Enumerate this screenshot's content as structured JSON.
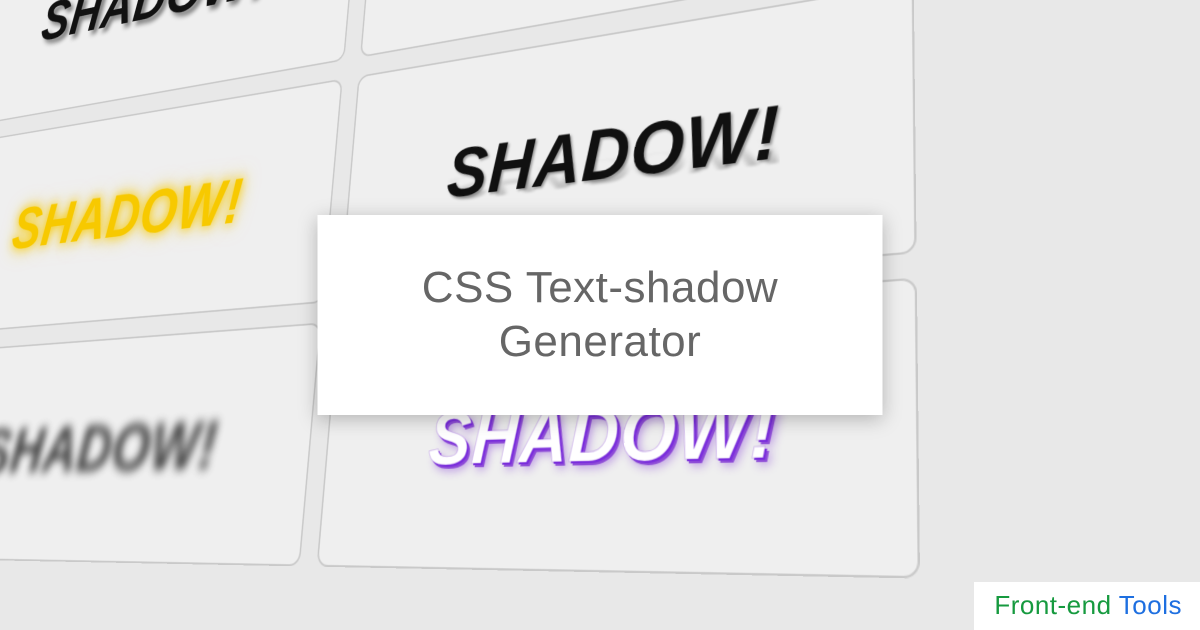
{
  "title": "CSS Text-shadow Generator",
  "sample_text": "SHADOW!",
  "brand": {
    "word1": "Front-end",
    "word2": " Tools"
  },
  "cards": [
    {
      "effect": "fx-offset-black"
    },
    {
      "effect": "fx-red"
    },
    {
      "effect": "fx-yellow-glow"
    },
    {
      "effect": "fx-reflect"
    },
    {
      "effect": "fx-blur"
    },
    {
      "effect": "fx-purple"
    }
  ]
}
